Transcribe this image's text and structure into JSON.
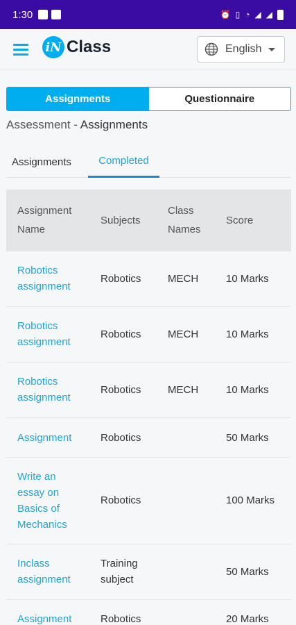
{
  "status_bar": {
    "time": "1:30"
  },
  "header": {
    "logo_mark": "iN",
    "logo_text": "Class",
    "language": "English"
  },
  "segmented": {
    "active": "Assignments",
    "inactive": "Questionnaire"
  },
  "breadcrumb": {
    "parent": "Assessment - ",
    "current": "Assignments"
  },
  "tabs": [
    {
      "label": "Assignments"
    },
    {
      "label": "Completed"
    }
  ],
  "table": {
    "columns": [
      {
        "line1": "Assignment",
        "line2": "Name"
      },
      {
        "line1": "Subjects",
        "line2": ""
      },
      {
        "line1": "Class",
        "line2": "Names"
      },
      {
        "line1": "Score",
        "line2": ""
      }
    ],
    "rows": [
      {
        "name": "Robotics assignment",
        "subject": "Robotics",
        "class": "MECH",
        "score": "10 Marks"
      },
      {
        "name": "Robotics assignment",
        "subject": "Robotics",
        "class": "MECH",
        "score": "10 Marks"
      },
      {
        "name": "Robotics assignment",
        "subject": "Robotics",
        "class": "MECH",
        "score": "10 Marks"
      },
      {
        "name": "Assignment",
        "subject": "Robotics",
        "class": "",
        "score": "50 Marks"
      },
      {
        "name": "Write an essay on Basics of Mechanics",
        "subject": "Robotics",
        "class": "",
        "score": "100 Marks"
      },
      {
        "name": "Inclass assignment",
        "subject": "Training subject",
        "class": "",
        "score": "50 Marks"
      },
      {
        "name": "Assignment",
        "subject": "Robotics",
        "class": "",
        "score": "20 Marks"
      }
    ]
  }
}
